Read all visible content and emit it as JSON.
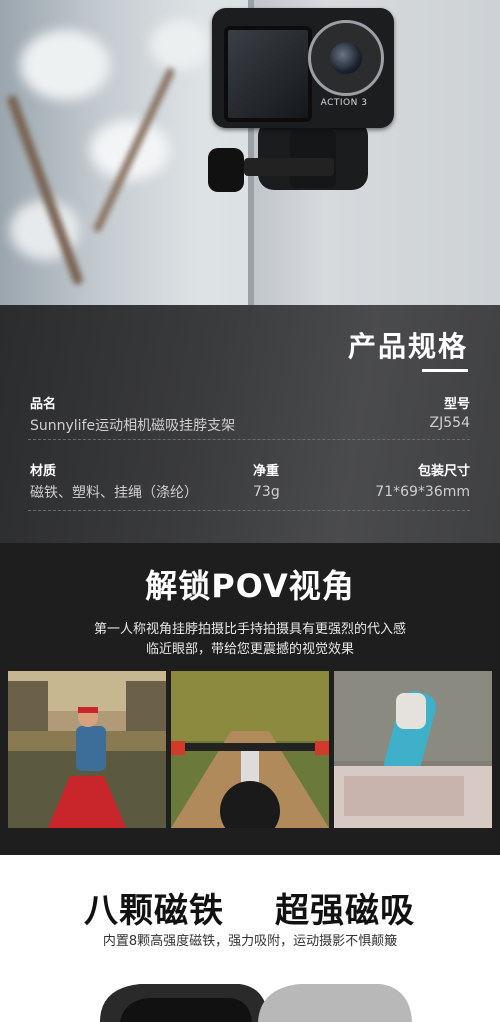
{
  "hero": {
    "camera_brand": "ACTION 3"
  },
  "spec": {
    "title": "产品规格",
    "name_label": "品名",
    "name_value": "Sunnylife运动相机磁吸挂脖支架",
    "model_label": "型号",
    "model_value": "ZJ554",
    "material_label": "材质",
    "material_value": "磁铁、塑料、挂绳（涤纶）",
    "weight_label": "净重",
    "weight_value": "73g",
    "package_label": "包装尺寸",
    "package_value": "71*69*36mm"
  },
  "pov": {
    "title": "解锁POV视角",
    "subtitle_line1": "第一人称视角挂脖拍摄比手持拍摄具有更强烈的代入感",
    "subtitle_line2": "临近眼部，带给您更震撼的视觉效果"
  },
  "magnet": {
    "title_left": "八颗磁铁",
    "title_right": "超强磁吸",
    "subtitle": "内置8颗高强度磁铁，强力吸附，运动摄影不惧颠簸"
  },
  "colors": {
    "spec_bg": "#3a3b3d",
    "pov_bg": "#1e1e1f",
    "canoe": "#c8262a",
    "skateboard": "#3fb0c9"
  }
}
